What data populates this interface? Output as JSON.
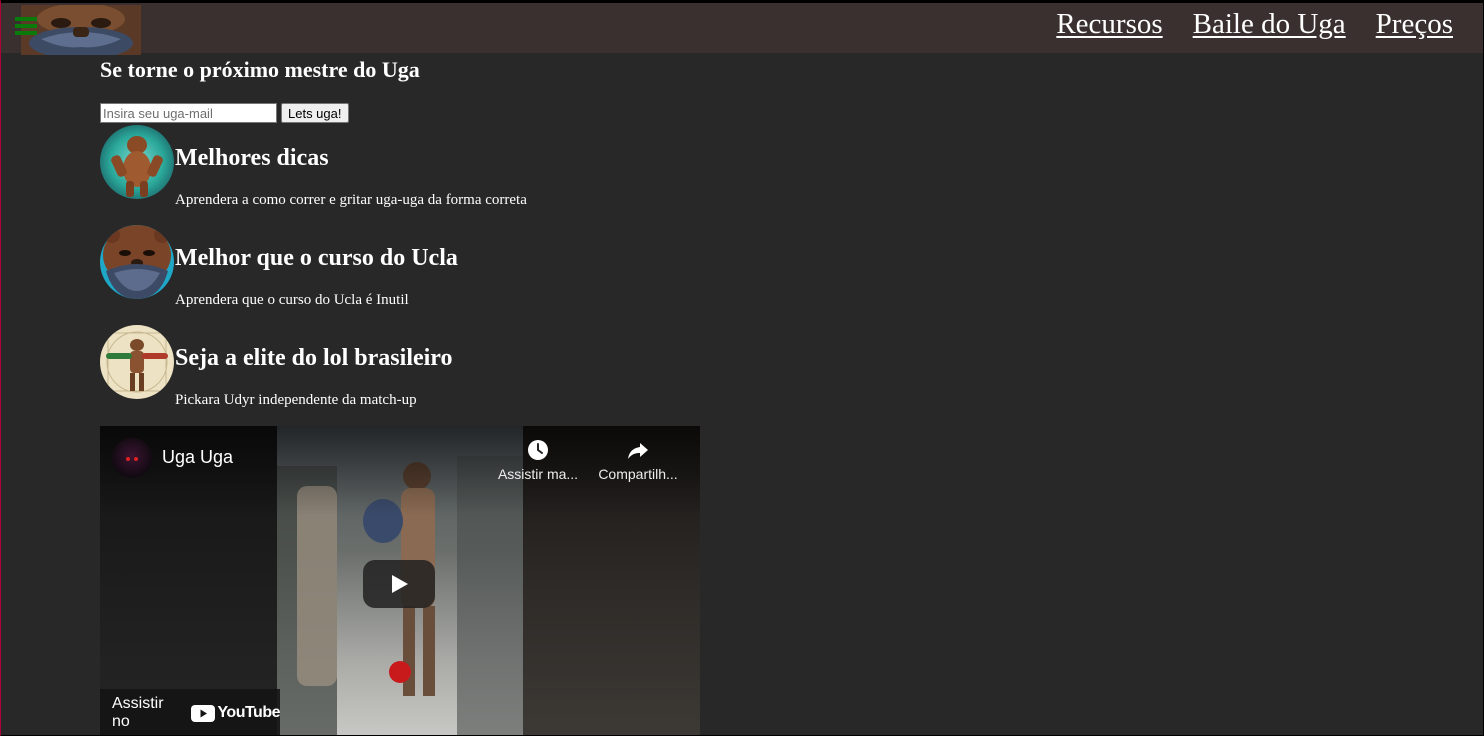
{
  "header": {
    "logo_icon": "uga-character-logo",
    "menu_icon": "hamburger-menu-icon",
    "nav": [
      {
        "label": "Recursos"
      },
      {
        "label": "Baile do Uga"
      },
      {
        "label": "Preços"
      }
    ]
  },
  "hero": {
    "headline": "Se torne o próximo mestre do Uga",
    "email_placeholder": "Insira seu uga-mail",
    "email_value": "",
    "submit_label": "Lets uga!"
  },
  "features": [
    {
      "title": "Melhores dicas",
      "description": "Aprendera a como correr e gritar uga-uga da forma correta",
      "icon": "bear-character-icon"
    },
    {
      "title": "Melhor que o curso do Ucla",
      "description": "Aprendera que o curso do Ucla é Inutil",
      "icon": "bear-face-icon"
    },
    {
      "title": "Seja a elite do lol brasileiro",
      "description": "Pickara Udyr independente da match-up",
      "icon": "vitruvian-bear-icon"
    }
  ],
  "video": {
    "title": "Uga Uga",
    "watch_later_label": "Assistir ma...",
    "share_label": "Compartilh...",
    "watch_on_label": "Assistir no",
    "platform_label": "YouTube"
  },
  "colors": {
    "background": "#282828",
    "header": "#3a3030",
    "text": "#ffffff",
    "menu_icon": "#0a7a0a",
    "yt_red": "#ff0000"
  }
}
